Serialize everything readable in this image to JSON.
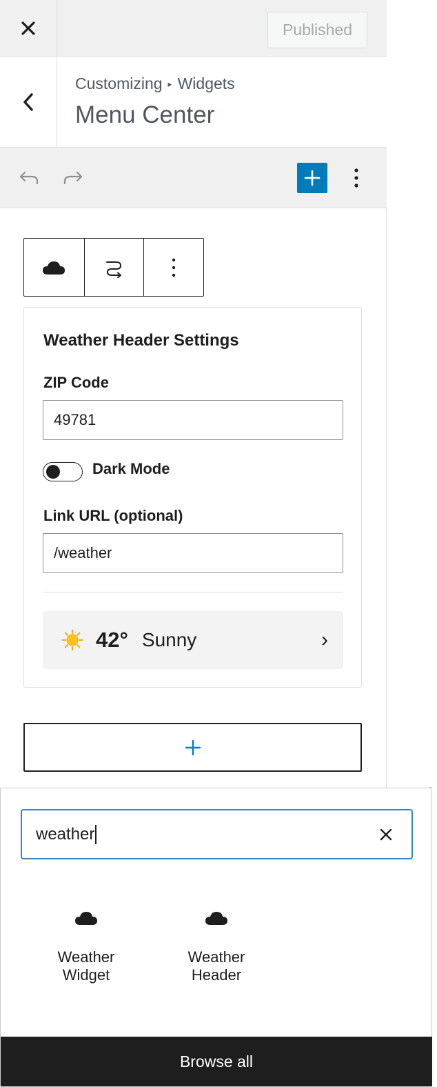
{
  "header": {
    "close_label": "Close",
    "published_label": "Published"
  },
  "section": {
    "breadcrumb_root": "Customizing",
    "breadcrumb_separator": "▸",
    "breadcrumb_current": "Widgets",
    "title": "Menu Center"
  },
  "toolbar": {
    "undo_icon": "undo-icon",
    "redo_icon": "redo-icon",
    "add_block_icon": "plus-icon",
    "options_icon": "more-vertical-icon",
    "accent_color": "#007cba"
  },
  "block_toolbar": {
    "items": [
      "cloud-icon",
      "transform-icon",
      "more-vertical-icon"
    ]
  },
  "widget": {
    "title": "Weather Header Settings",
    "zip_label": "ZIP Code",
    "zip_value": "49781",
    "dark_mode_label": "Dark Mode",
    "dark_mode_on": false,
    "link_label": "Link URL (optional)",
    "link_value": "/weather",
    "preview": {
      "icon": "sun-icon",
      "temperature": "42°",
      "condition": "Sunny",
      "chevron": "›"
    }
  },
  "appender": {
    "icon": "plus-icon"
  },
  "inserter": {
    "search_value": "weather",
    "results": [
      {
        "icon": "cloud-icon",
        "label_line1": "Weather",
        "label_line2": "Widget"
      },
      {
        "icon": "cloud-icon",
        "label_line1": "Weather",
        "label_line2": "Header"
      }
    ],
    "browse_all_label": "Browse all"
  }
}
